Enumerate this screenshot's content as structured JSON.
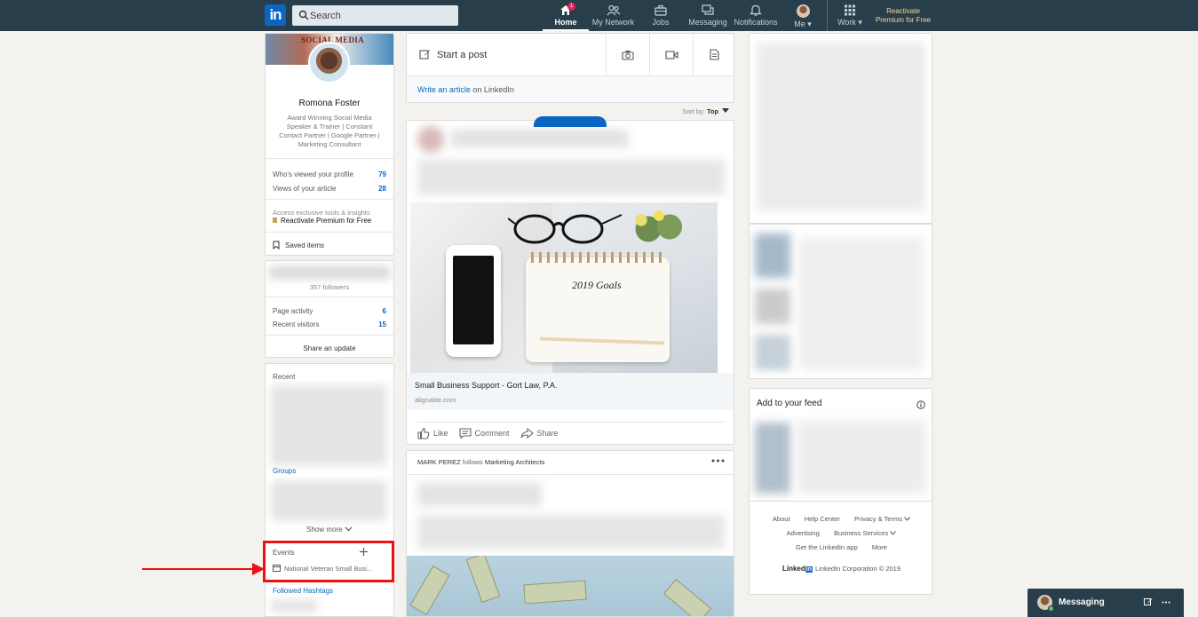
{
  "nav": {
    "logo": "in",
    "search_placeholder": "Search",
    "items": [
      {
        "label": "Home",
        "icon": "home-icon",
        "badge": "1"
      },
      {
        "label": "My Network",
        "icon": "network-icon"
      },
      {
        "label": "Jobs",
        "icon": "briefcase-icon"
      },
      {
        "label": "Messaging",
        "icon": "messaging-icon"
      },
      {
        "label": "Notifications",
        "icon": "bell-icon"
      },
      {
        "label": "Me ▾",
        "icon": "avatar"
      },
      {
        "label": "Work ▾",
        "icon": "grid-icon"
      }
    ],
    "premium_line1": "Reactivate",
    "premium_line2": "Premium for Free"
  },
  "profile": {
    "cover_title": "SOCIAL MEDIA",
    "name": "Romona Foster",
    "tagline": "Award Winning Social Media Speaker & Trainer | Constant Contact Partner | Google Partner | Marketing Consultant",
    "viewed_label": "Who's viewed your profile",
    "viewed_value": "79",
    "article_label": "Views of your article",
    "article_value": "28",
    "premium_text": "Access exclusive tools & insights",
    "premium_link": "Reactivate Premium for Free",
    "saved_items": "Saved items"
  },
  "page_card": {
    "followers": "357 followers",
    "activity_label": "Page activity",
    "activity_value": "6",
    "visitors_label": "Recent visitors",
    "visitors_value": "15",
    "share_update": "Share an update"
  },
  "sidebar": {
    "recent": "Recent",
    "groups": "Groups",
    "show_more": "Show more",
    "events": "Events",
    "event_item": "National Veteran Small Busi...",
    "followed_hashtags": "Followed Hashtags"
  },
  "share_box": {
    "start_post": "Start a post",
    "write_article": "Write an article",
    "on_linkedin": "on LinkedIn"
  },
  "feed": {
    "sort_by_label": "Sort by:",
    "sort_by_value": "Top",
    "post1": {
      "image_text": "2019 Goals",
      "link_title": "Small Business Support - Gort Law, P.A.",
      "link_domain": "alignable.com",
      "like": "Like",
      "comment": "Comment",
      "share": "Share"
    },
    "post2": {
      "actor": "MARK PEREZ",
      "follows": "follows",
      "company": "Marketing Architects"
    }
  },
  "right": {
    "add_to_feed": "Add to your feed",
    "footer": {
      "links_row1": [
        "About",
        "Help Center",
        "Privacy & Terms"
      ],
      "links_row2": [
        "Advertising",
        "Business Services"
      ],
      "links_row3": [
        "Get the LinkedIn app",
        "More"
      ],
      "brand": "Linked",
      "brand_in": "in",
      "copyright": "LinkedIn Corporation © 2019"
    }
  },
  "messaging_bar": {
    "label": "Messaging"
  },
  "colors": {
    "nav_bg": "#283e4a",
    "link_blue": "#0a66c2",
    "highlight_red": "#ee1111"
  }
}
